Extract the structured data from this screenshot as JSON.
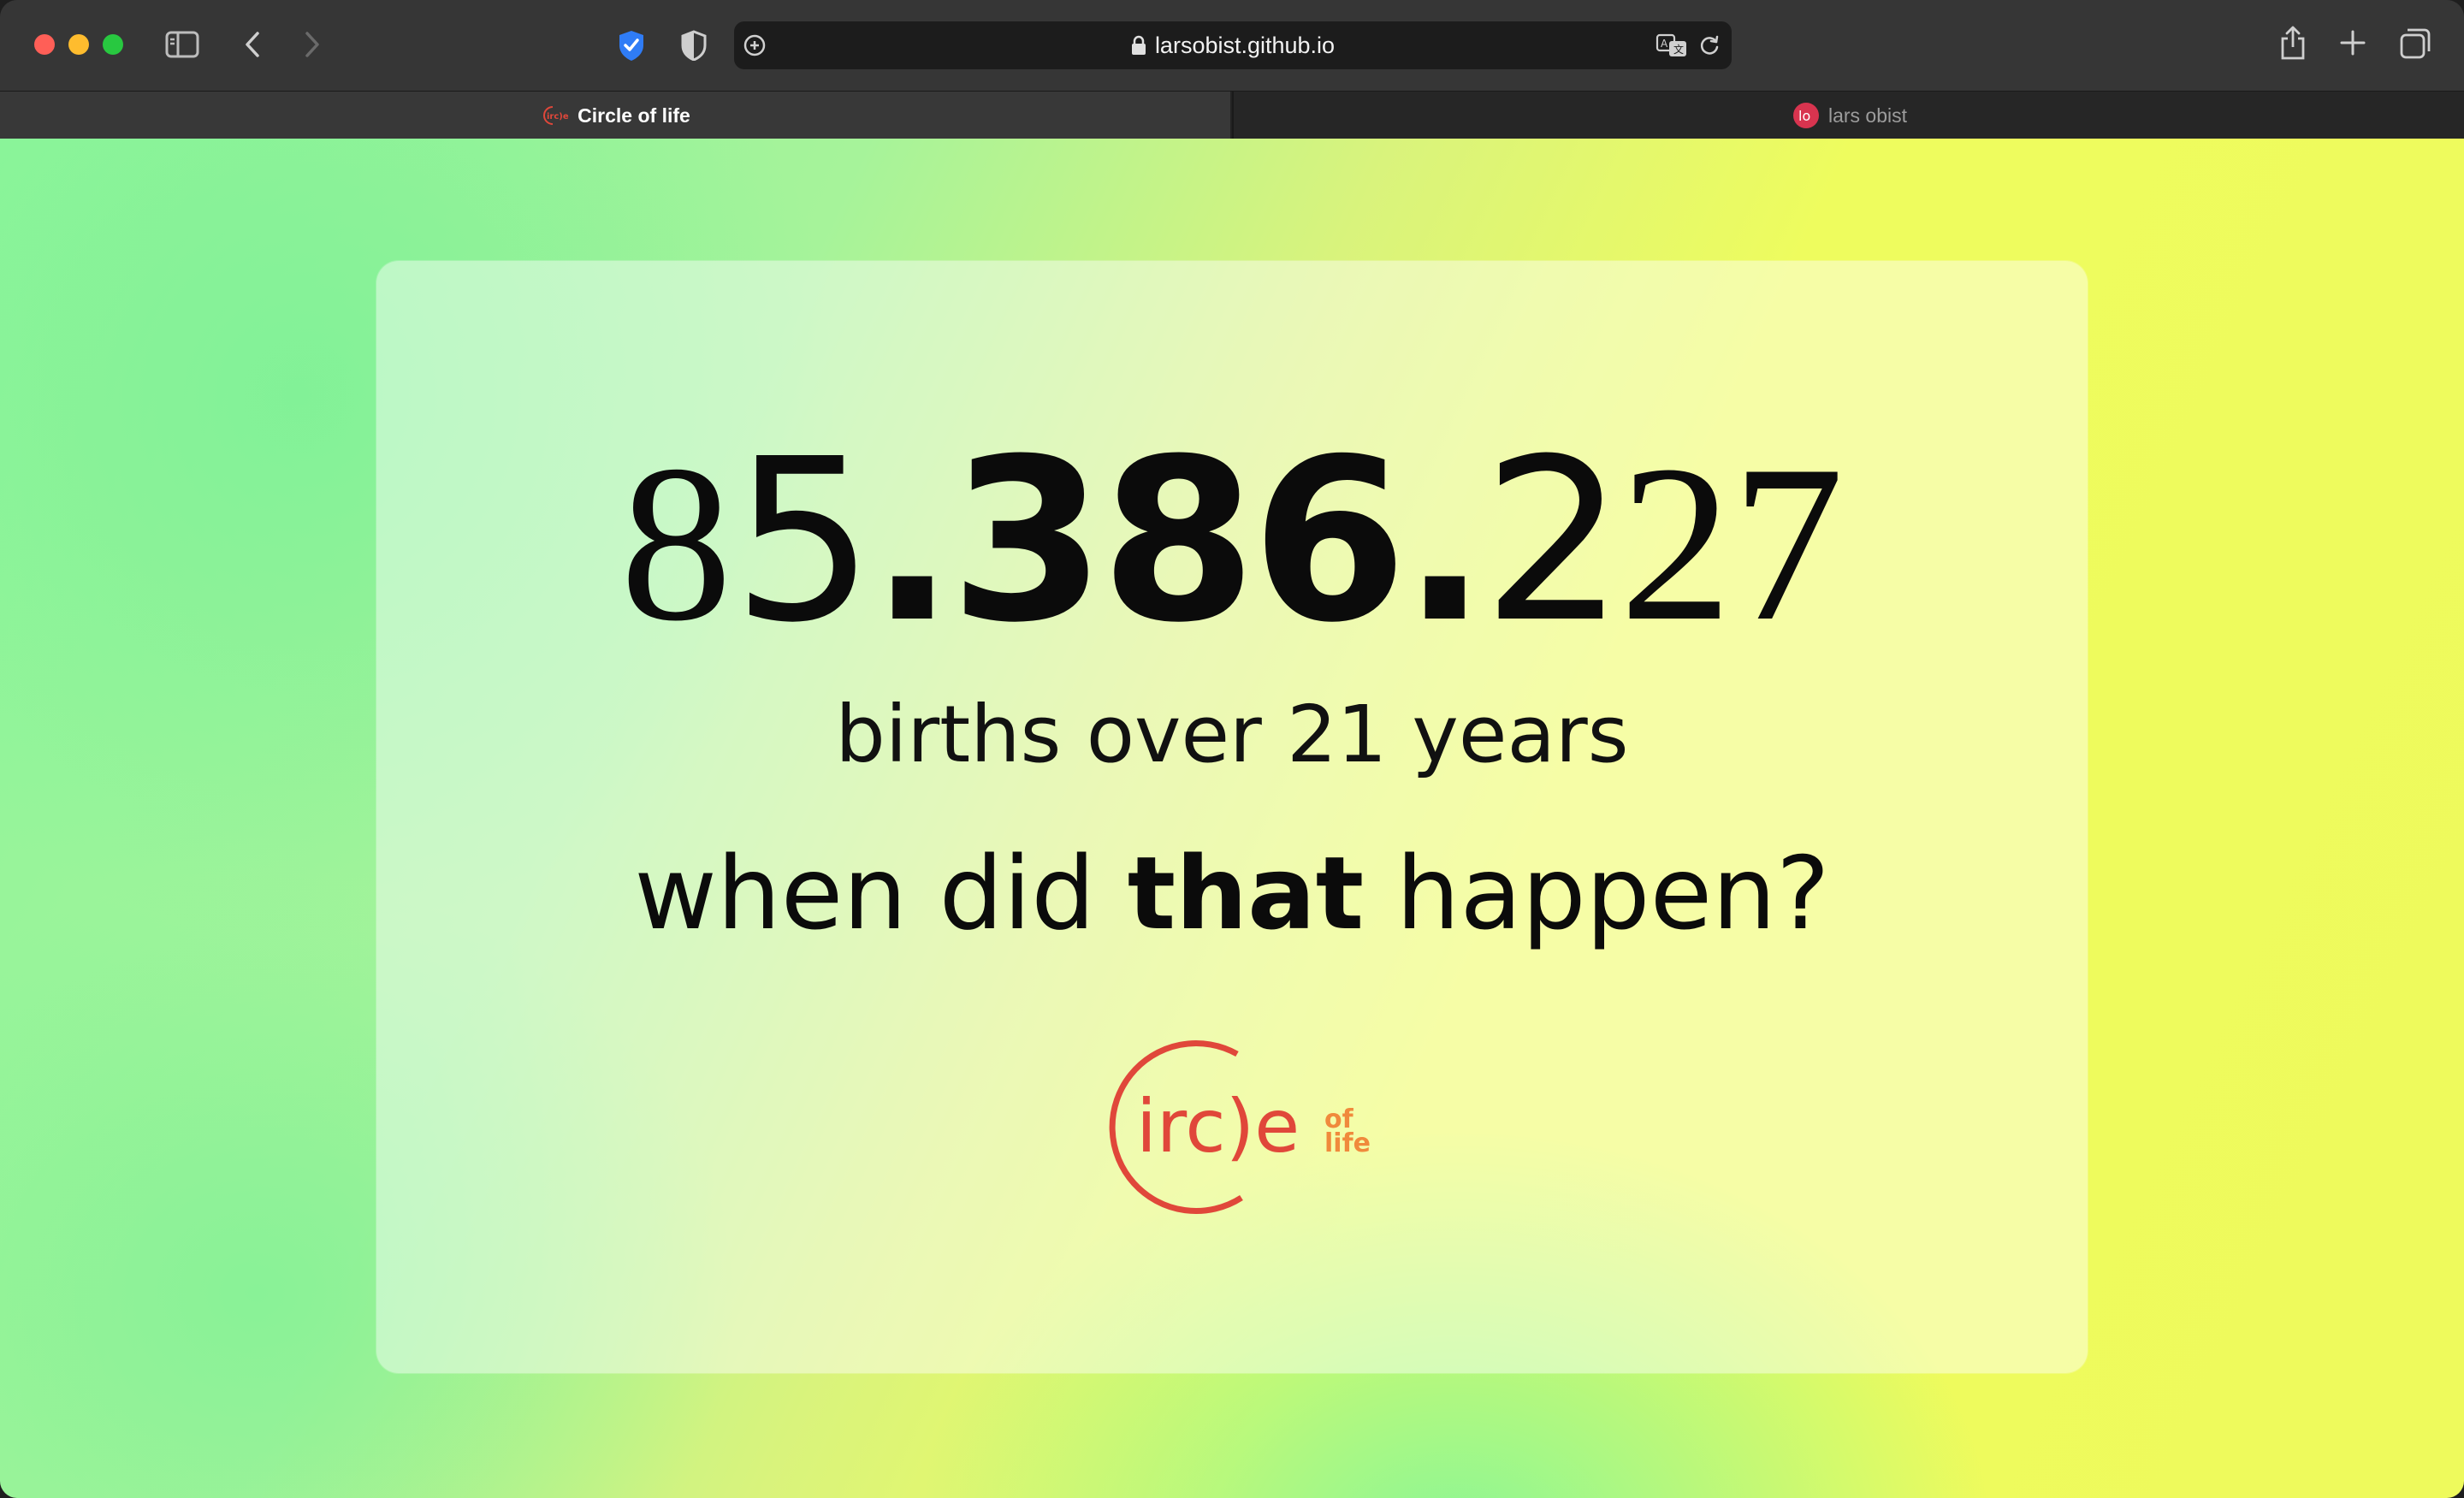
{
  "browser": {
    "url": "larsobist.github.io",
    "icons": [
      "sidebar-icon",
      "back-icon",
      "forward-icon",
      "bitwarden-shield-icon",
      "privacy-shield-icon",
      "site-settings-icon",
      "lock-icon",
      "translate-icon",
      "reload-icon",
      "share-icon",
      "new-tab-icon",
      "tab-overview-icon"
    ],
    "tabs": [
      {
        "title": "Circle of life",
        "favicon": "circle-of-life-favicon",
        "active": true
      },
      {
        "title": "lars obist",
        "favicon": "lo-favicon",
        "active": false
      }
    ]
  },
  "main": {
    "count_parts": {
      "light": "8",
      "regular": "5",
      "bold": ".386.",
      "regular_tail": "2",
      "thin_tail": "27"
    },
    "subtitle": "births over 21 years",
    "question": {
      "before": "when did ",
      "emphasis": "that",
      "after": " happen?"
    },
    "logo": {
      "main": "irc)e",
      "of": "of",
      "life": "life",
      "color": "#e0473a",
      "secondary_color": "#f08a3c"
    }
  },
  "colors": {
    "background_green": "#8ef59a",
    "background_yellow": "#eefa5c",
    "text": "#0b0b0b"
  }
}
